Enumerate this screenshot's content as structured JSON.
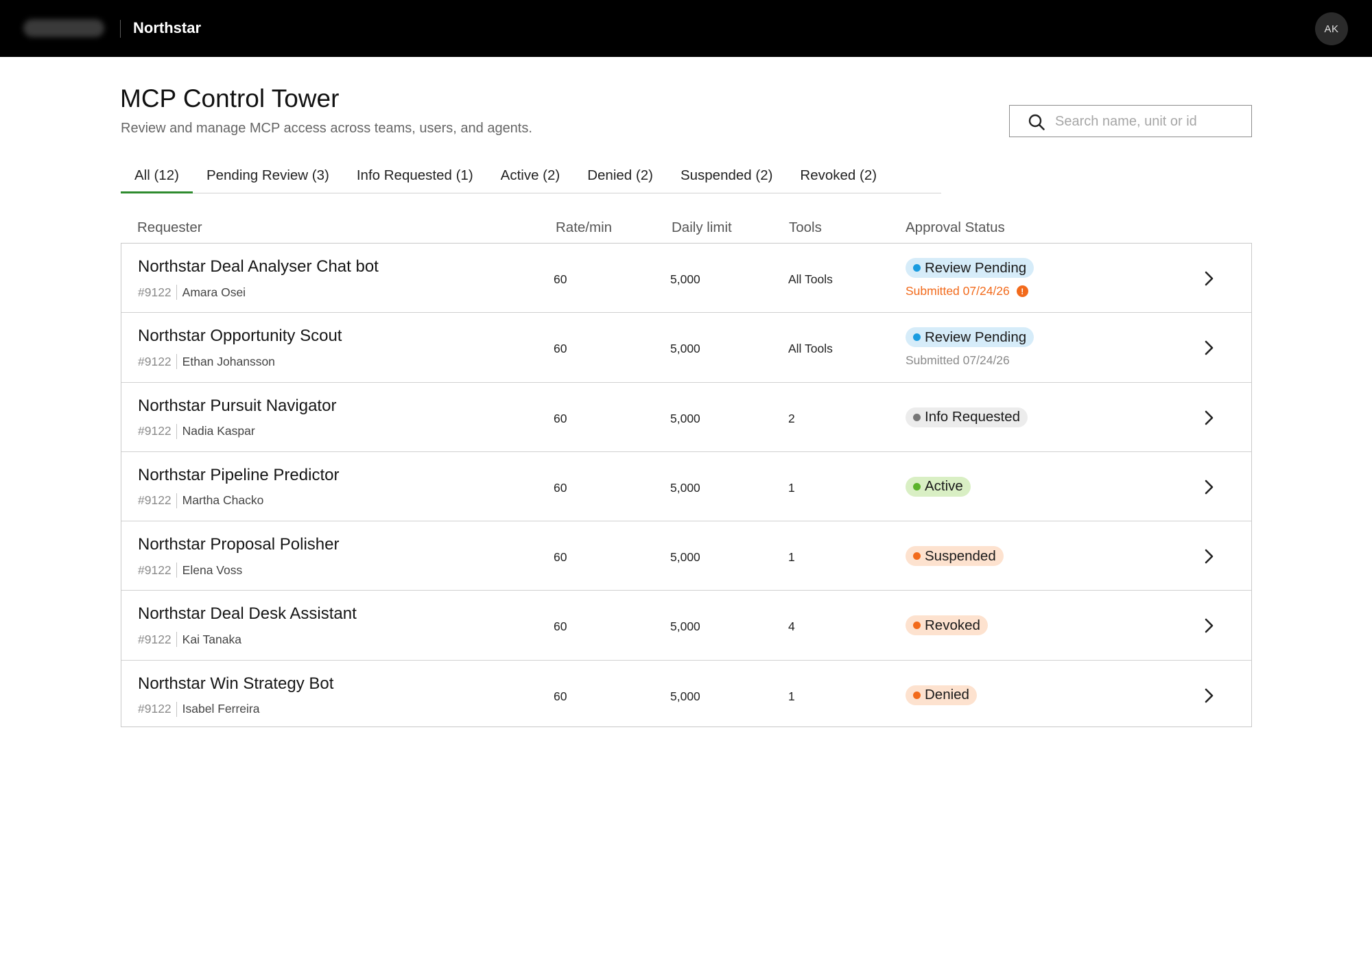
{
  "header": {
    "brand": "Northstar",
    "avatar_initials": "AK"
  },
  "page": {
    "title": "MCP Control Tower",
    "subtitle": "Review and manage MCP access across teams, users, and agents."
  },
  "search": {
    "placeholder": "Search name, unit or id",
    "value": ""
  },
  "tabs": [
    {
      "label": "All (12)",
      "active": true
    },
    {
      "label": "Pending Review (3)",
      "active": false
    },
    {
      "label": "Info Requested (1)",
      "active": false
    },
    {
      "label": "Active (2)",
      "active": false
    },
    {
      "label": "Denied (2)",
      "active": false
    },
    {
      "label": "Suspended (2)",
      "active": false
    },
    {
      "label": "Revoked (2)",
      "active": false
    }
  ],
  "columns": {
    "requester": "Requester",
    "rate": "Rate/min",
    "daily": "Daily limit",
    "tools": "Tools",
    "status": "Approval Status"
  },
  "colors": {
    "accent_tab": "#2e8b2e",
    "review_pending_bg": "#d6ecf9",
    "review_pending_dot": "#1a9ce0",
    "info_requested_bg": "#ececec",
    "info_requested_dot": "#777777",
    "active_bg": "#d9efc4",
    "active_dot": "#5bb32b",
    "warning_bg": "#fde2cf",
    "warning_dot": "#f26a1b",
    "submitted_alert": "#f26a1b",
    "submitted_normal": "#8a8a8a"
  },
  "rows": [
    {
      "name": "Northstar Deal Analyser Chat bot",
      "id": "#9122",
      "owner": "Amara Osei",
      "rate": "60",
      "daily": "5,000",
      "tools": "All Tools",
      "status": "Review Pending",
      "status_kind": "pending",
      "submitted": "Submitted 07/24/26",
      "submitted_alert": true
    },
    {
      "name": "Northstar Opportunity Scout",
      "id": "#9122",
      "owner": "Ethan Johansson",
      "rate": "60",
      "daily": "5,000",
      "tools": "All Tools",
      "status": "Review Pending",
      "status_kind": "pending",
      "submitted": "Submitted 07/24/26",
      "submitted_alert": false
    },
    {
      "name": "Northstar Pursuit Navigator",
      "id": "#9122",
      "owner": "Nadia Kaspar",
      "rate": "60",
      "daily": "5,000",
      "tools": "2",
      "status": "Info Requested",
      "status_kind": "info",
      "submitted": "",
      "submitted_alert": false
    },
    {
      "name": "Northstar Pipeline Predictor",
      "id": "#9122",
      "owner": "Martha Chacko",
      "rate": "60",
      "daily": "5,000",
      "tools": "1",
      "status": "Active",
      "status_kind": "active",
      "submitted": "",
      "submitted_alert": false
    },
    {
      "name": "Northstar Proposal Polisher",
      "id": "#9122",
      "owner": "Elena Voss",
      "rate": "60",
      "daily": "5,000",
      "tools": "1",
      "status": "Suspended",
      "status_kind": "warning",
      "submitted": "",
      "submitted_alert": false
    },
    {
      "name": "Northstar Deal Desk Assistant",
      "id": "#9122",
      "owner": "Kai Tanaka",
      "rate": "60",
      "daily": "5,000",
      "tools": "4",
      "status": "Revoked",
      "status_kind": "warning",
      "submitted": "",
      "submitted_alert": false
    },
    {
      "name": "Northstar Win Strategy Bot",
      "id": "#9122",
      "owner": "Isabel Ferreira",
      "rate": "60",
      "daily": "5,000",
      "tools": "1",
      "status": "Denied",
      "status_kind": "warning",
      "submitted": "",
      "submitted_alert": false
    }
  ]
}
